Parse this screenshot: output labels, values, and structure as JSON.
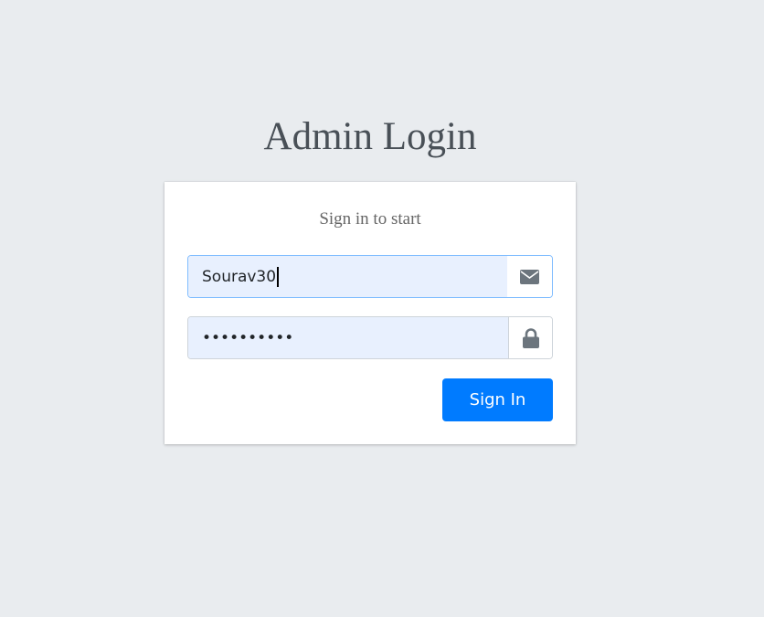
{
  "page": {
    "title": "Admin Login"
  },
  "login_card": {
    "subtitle": "Sign in to start",
    "email_input": {
      "value": "Sourav30",
      "icon": "envelope-icon"
    },
    "password_input": {
      "value": "••••••••••",
      "icon": "lock-icon"
    },
    "submit_label": "Sign In"
  },
  "colors": {
    "background": "#e9ecef",
    "primary": "#007bff",
    "autofill": "#e8f0fe",
    "focus_border": "#80bdff",
    "icon": "#6c757d"
  }
}
